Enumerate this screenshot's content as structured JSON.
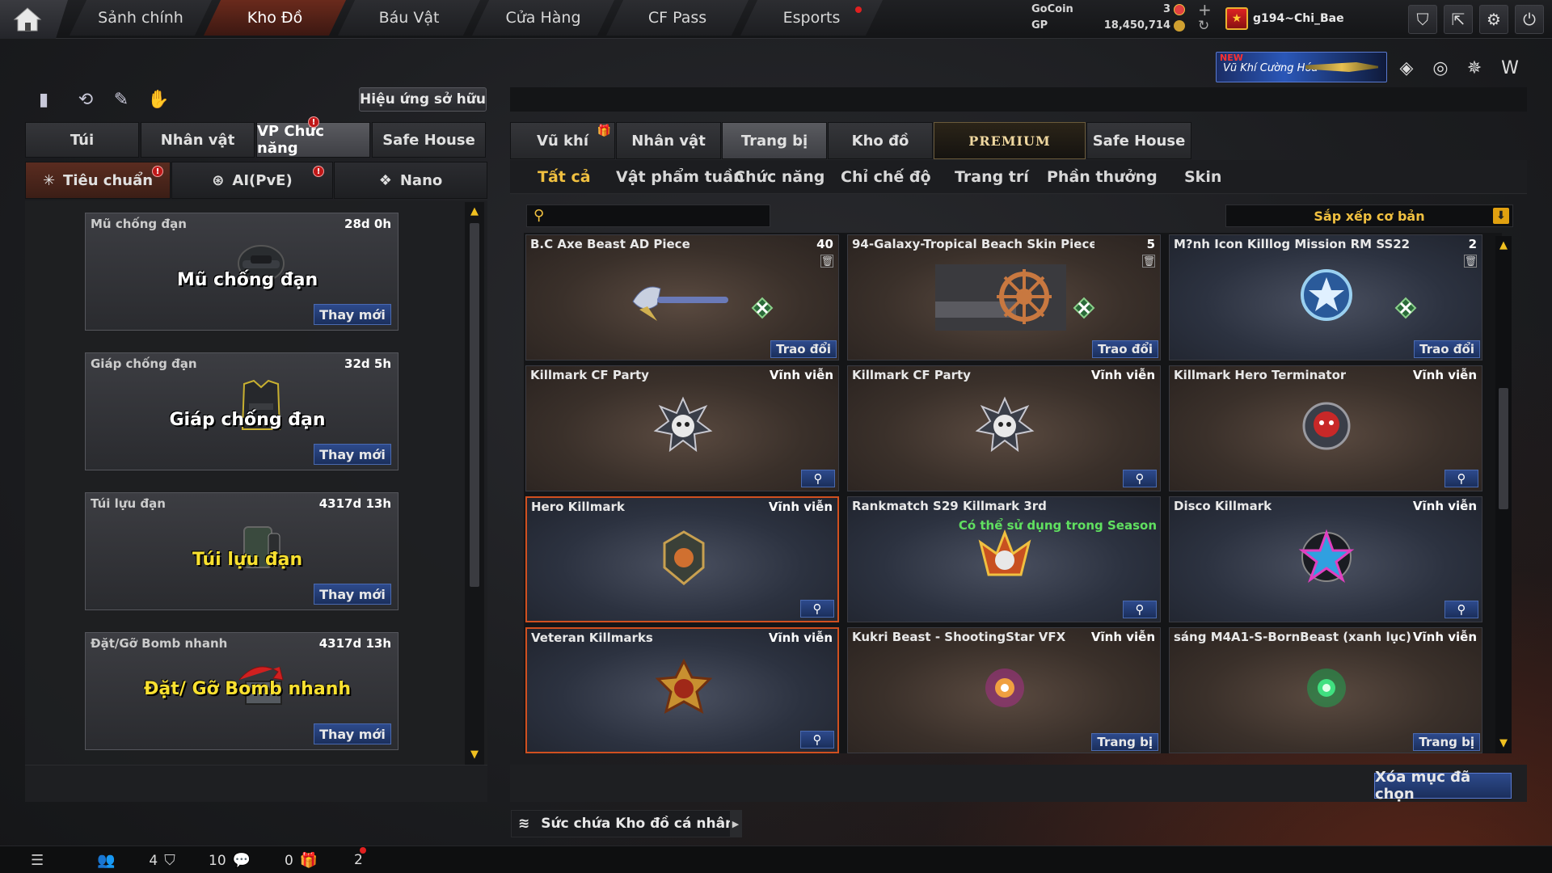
{
  "nav": {
    "tabs": [
      "Sảnh chính",
      "Kho Đồ",
      "Báu Vật",
      "Cửa Hàng",
      "CF Pass",
      "Esports"
    ]
  },
  "currency": {
    "gocoin_label": "GoCoin",
    "gocoin_value": "3",
    "gp_label": "GP",
    "gp_value": "18,450,714"
  },
  "player": {
    "name": "g194~Chi_Bae"
  },
  "promo": {
    "badge": "NEW",
    "text": "Vũ Khí Cường Hóa"
  },
  "left": {
    "owned_effects_button": "Hiệu ứng sở hữu",
    "tabs": [
      "Túi",
      "Nhân vật",
      "VP Chức năng",
      "Safe House"
    ],
    "subtabs": [
      "Tiêu chuẩn",
      "AI(PvE)",
      "Nano"
    ],
    "items": [
      {
        "name": "Mũ chống đạn",
        "time": "28d 0h",
        "big": "Mũ chống đạn",
        "button": "Thay mới"
      },
      {
        "name": "Giáp chống đạn",
        "time": "32d 5h",
        "big": "Giáp chống đạn",
        "button": "Thay mới"
      },
      {
        "name": "Túi lựu đạn",
        "time": "4317d 13h",
        "big": "Túi lựu đạn",
        "button": "Thay mới"
      },
      {
        "name": "Đặt/Gỡ Bomb nhanh",
        "time": "4317d 13h",
        "big": "Đặt/ Gỡ Bomb nhanh",
        "button": "Thay mới"
      }
    ]
  },
  "right": {
    "tabs": [
      "Vũ khí",
      "Nhân vật",
      "Trang bị",
      "Kho đồ",
      "PREMIUM",
      "Safe House"
    ],
    "subtabs": [
      "Tất cả",
      "Vật phẩm tuần",
      "Chức năng",
      "Chỉ chế độ",
      "Trang trí",
      "Phần thưởng",
      "Skin"
    ],
    "search_placeholder": "",
    "sort_label": "Sắp xếp cơ bản",
    "cards": [
      {
        "name": "B.C Axe Beast AD Piece",
        "count": "40",
        "action": "Trao đổi"
      },
      {
        "name": "94-Galaxy-Tropical Beach Skin Piece",
        "count": "5",
        "action": "Trao đổi"
      },
      {
        "name": "M?nh Icon Killlog Mission RM SS22",
        "count": "2",
        "action": "Trao đổi"
      },
      {
        "name": "Killmark CF Party",
        "duration": "Vĩnh viễn"
      },
      {
        "name": "Killmark CF Party",
        "duration": "Vĩnh viễn"
      },
      {
        "name": "Killmark Hero Terminator",
        "duration": "Vĩnh viễn"
      },
      {
        "name": "Hero Killmark",
        "duration": "Vĩnh viễn"
      },
      {
        "name": "Rankmatch S29 Killmark 3rd",
        "note": "Có thể sử dụng trong Season"
      },
      {
        "name": "Disco Killmark",
        "duration": "Vĩnh viễn"
      },
      {
        "name": "Veteran Killmarks",
        "duration": "Vĩnh viễn"
      },
      {
        "name": "Kukri Beast - ShootingStar VFX",
        "duration": "Vĩnh viễn",
        "action": "Trang bị"
      },
      {
        "name": "sáng M4A1-S-BornBeast (xanh lục)",
        "duration": "Vĩnh viễn",
        "action": "Trang bị"
      }
    ],
    "delete_button": "Xóa mục đã chọn",
    "capacity_label": "Sức chứa Kho đồ cá nhân"
  },
  "status": {
    "friends": "4",
    "clan": "10",
    "chat": "0",
    "gifts": "2"
  },
  "colors": {
    "accent": "#f0c040",
    "active_tab": "#6a2a1c",
    "button_blue": "#2d4a8c",
    "selected_border": "#d05020"
  }
}
